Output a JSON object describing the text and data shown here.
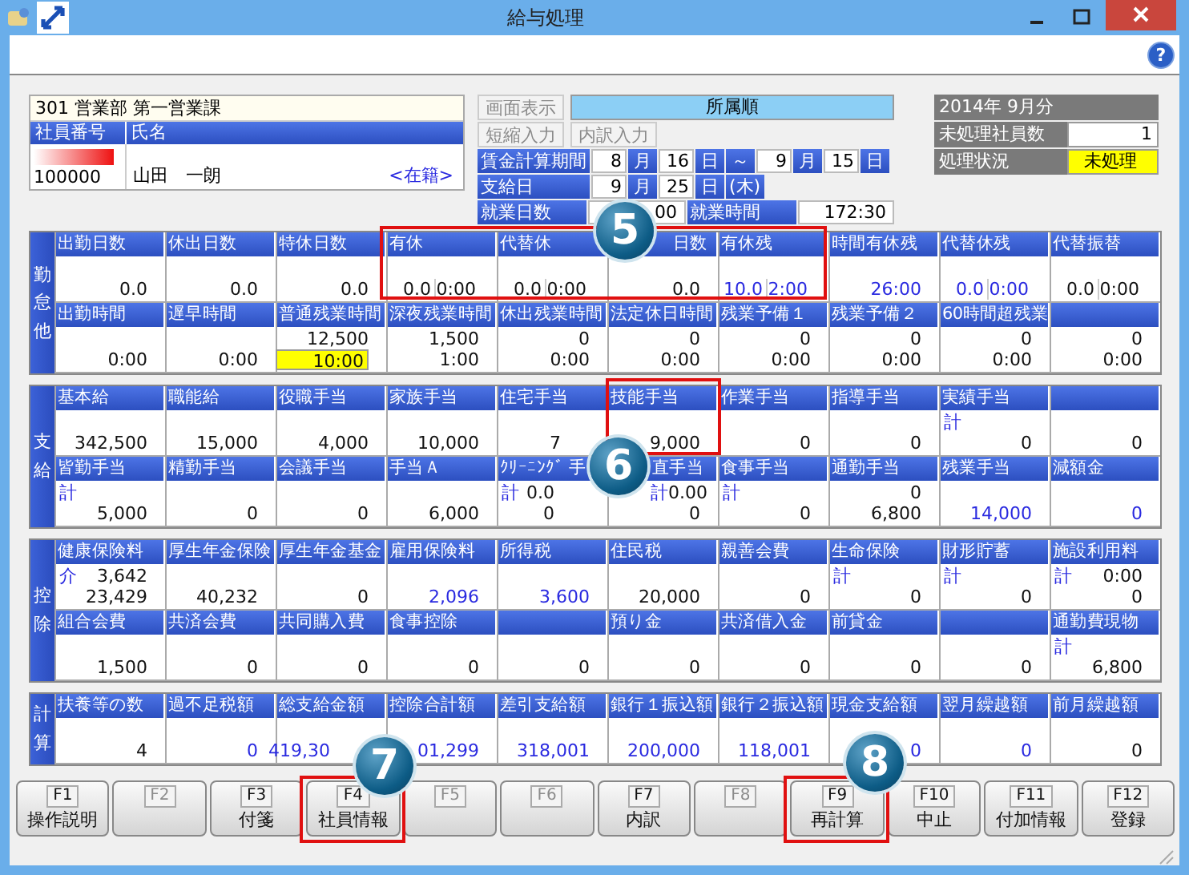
{
  "window": {
    "title": "給与処理"
  },
  "toolbar": {
    "help": "?"
  },
  "employee": {
    "department": "301 営業部 第一営業課",
    "columns": [
      "社員番号",
      "氏名"
    ],
    "number": "100000",
    "name": "山田　一朗",
    "status": "<在籍>"
  },
  "display": {
    "order": "所属順",
    "buttons": [
      {
        "label": "画面表示",
        "disabled": true
      },
      {
        "label": "短縮入力",
        "disabled": true
      },
      {
        "label": "内訳入力",
        "disabled": true
      }
    ]
  },
  "period": [
    [
      {
        "kind": "label",
        "text": "賃金計算期間"
      },
      {
        "kind": "value",
        "text": "8"
      },
      {
        "kind": "unit",
        "text": "月"
      },
      {
        "kind": "value",
        "text": "16"
      },
      {
        "kind": "unit",
        "text": "日"
      },
      {
        "kind": "unit",
        "text": "～"
      },
      {
        "kind": "value",
        "text": "9"
      },
      {
        "kind": "unit",
        "text": "月"
      },
      {
        "kind": "value",
        "text": "15"
      },
      {
        "kind": "unit",
        "text": "日"
      }
    ],
    [
      {
        "kind": "label",
        "text": "支給日"
      },
      {
        "kind": "value",
        "text": "9"
      },
      {
        "kind": "unit",
        "text": "月"
      },
      {
        "kind": "value",
        "text": "25"
      },
      {
        "kind": "unit",
        "text": "日"
      },
      {
        "kind": "unit",
        "text": "(木)"
      }
    ],
    [
      {
        "kind": "label",
        "text": "就業日数"
      },
      {
        "kind": "field",
        "text": "00"
      },
      {
        "kind": "label",
        "text": "就業時間"
      },
      {
        "kind": "field",
        "text": "172:30"
      }
    ]
  ],
  "summary": {
    "title": "2014年 9月分",
    "rows": [
      {
        "label": "未処理社員数",
        "value": "1",
        "alert": false
      },
      {
        "label": "処理状況",
        "value": "未処理",
        "alert": true
      }
    ]
  },
  "sections": [
    {
      "title": "勤怠他",
      "rows": [
        [
          {
            "label": "出勤日数",
            "value": "0.0",
            "emphasized": false
          },
          {
            "label": "休出日数",
            "value": "0.0",
            "emphasized": false
          },
          {
            "label": "特休日数",
            "value": "0.0",
            "emphasized": false
          },
          {
            "label": "有休",
            "parts": [
              "0.0",
              "0:00"
            ],
            "emphasized": false
          },
          {
            "label": "代替休",
            "parts": [
              "0.0",
              "0:00"
            ],
            "emphasized": false
          },
          {
            "label": "日数",
            "value": "0.0",
            "emphasized": false
          },
          {
            "label": "有休残",
            "parts": [
              "10.0",
              "2:00"
            ],
            "emphasized": true
          },
          {
            "label": "時間有休残",
            "value": "26:00",
            "emphasized": true
          },
          {
            "label": "代替休残",
            "parts": [
              "0.0",
              "0:00"
            ],
            "emphasized": true
          },
          {
            "label": "代替振替",
            "parts": [
              "0.0",
              "0:00"
            ],
            "emphasized": false
          }
        ],
        [
          {
            "label": "出勤時間",
            "value": "0:00",
            "emphasized": false,
            "focused": false
          },
          {
            "label": "遅早時間",
            "value": "0:00",
            "emphasized": false,
            "focused": false
          },
          {
            "label": "普通残業時間",
            "upper": "12,500",
            "value": "10:00",
            "emphasized": false,
            "focused": true
          },
          {
            "label": "深夜残業時間",
            "upper": "1,500",
            "value": "1:00",
            "emphasized": false,
            "focused": false
          },
          {
            "label": "休出残業時間",
            "upper": "0",
            "value": "0:00",
            "emphasized": false,
            "focused": false
          },
          {
            "label": "法定休日時間",
            "upper": "0",
            "value": "0:00",
            "emphasized": false,
            "focused": false
          },
          {
            "label": "残業予備１",
            "upper": "0",
            "value": "0:00",
            "emphasized": false,
            "focused": false
          },
          {
            "label": "残業予備２",
            "upper": "0",
            "value": "0:00",
            "emphasized": false,
            "focused": false
          },
          {
            "label": "60時間超残業",
            "upper": "0",
            "value": "0:00",
            "emphasized": false,
            "focused": false
          },
          {
            "upper": "0",
            "value": "0:00",
            "emphasized": false,
            "focused": false
          }
        ]
      ]
    },
    {
      "title": "支給",
      "rows": [
        [
          {
            "label": "基本給",
            "value": "342,500",
            "emphasized": false
          },
          {
            "label": "職能給",
            "value": "15,000",
            "emphasized": false
          },
          {
            "label": "役職手当",
            "value": "4,000",
            "emphasized": false
          },
          {
            "label": "家族手当",
            "value": "10,000",
            "emphasized": false
          },
          {
            "label": "住宅手当",
            "value": "7",
            "emphasized": false
          },
          {
            "label": "技能手当",
            "value": "9,000",
            "emphasized": false
          },
          {
            "label": "作業手当",
            "value": "0",
            "emphasized": false
          },
          {
            "label": "指導手当",
            "value": "0",
            "emphasized": false
          },
          {
            "label": "実績手当",
            "note": "計",
            "value": "0",
            "emphasized": false
          },
          {
            "value": "0",
            "emphasized": false
          }
        ],
        [
          {
            "label": "皆勤手当",
            "note": "計",
            "value": "5,000",
            "emphasized": false
          },
          {
            "label": "精勤手当",
            "value": "0",
            "emphasized": false
          },
          {
            "label": "会議手当",
            "value": "0",
            "emphasized": false
          },
          {
            "label": "手当Ａ",
            "value": "6,000",
            "emphasized": false
          },
          {
            "label": "ｸﾘｰﾆﾝｸﾞ 手",
            "note": "計",
            "upper": "0.0",
            "value": "0",
            "emphasized": false
          },
          {
            "label": "直手当",
            "note": "計",
            "upper": "0.00",
            "value": "0",
            "emphasized": false
          },
          {
            "label": "食事手当",
            "note": "計",
            "value": "0",
            "emphasized": false
          },
          {
            "label": "通勤手当",
            "upper": "0",
            "value": "6,800",
            "emphasized": false
          },
          {
            "label": "残業手当",
            "value": "14,000",
            "emphasized": true
          },
          {
            "label": "減額金",
            "value": "0",
            "emphasized": true
          }
        ]
      ]
    },
    {
      "title": "控除",
      "rows": [
        [
          {
            "label": "健康保険料",
            "note": "介",
            "upper": "3,642",
            "value": "23,429",
            "emphasized": false
          },
          {
            "label": "厚生年金保険",
            "value": "40,232",
            "emphasized": false
          },
          {
            "label": "厚生年金基金",
            "value": "0",
            "emphasized": false
          },
          {
            "label": "雇用保険料",
            "value": "2,096",
            "emphasized": true
          },
          {
            "label": "所得税",
            "value": "3,600",
            "emphasized": true
          },
          {
            "label": "住民税",
            "value": "20,000",
            "emphasized": false
          },
          {
            "label": "親善会費",
            "value": "0",
            "emphasized": false
          },
          {
            "label": "生命保険",
            "note": "計",
            "value": "0",
            "emphasized": false
          },
          {
            "label": "財形貯蓄",
            "note": "計",
            "value": "0",
            "emphasized": false
          },
          {
            "label": "施設利用料",
            "note": "計",
            "upper": "0:00",
            "value": "0",
            "emphasized": false
          }
        ],
        [
          {
            "label": "組合会費",
            "value": "1,500",
            "emphasized": false
          },
          {
            "label": "共済会費",
            "value": "0",
            "emphasized": false
          },
          {
            "label": "共同購入費",
            "value": "0",
            "emphasized": false
          },
          {
            "label": "食事控除",
            "value": "0",
            "emphasized": false
          },
          {
            "value": "0",
            "emphasized": false
          },
          {
            "label": "預り金",
            "value": "0",
            "emphasized": false
          },
          {
            "label": "共済借入金",
            "value": "0",
            "emphasized": false
          },
          {
            "label": "前貸金",
            "value": "0",
            "emphasized": false
          },
          {
            "value": "0",
            "emphasized": false
          },
          {
            "label": "通勤費現物",
            "note": "計",
            "value": "6,800",
            "emphasized": false
          }
        ]
      ]
    },
    {
      "title": "計算",
      "rows": [
        [
          {
            "label": "扶養等の数",
            "value": "4",
            "emphasized": false
          },
          {
            "label": "過不足税額",
            "value": "0",
            "emphasized": true
          },
          {
            "label": "総支給金額",
            "value": "419,30",
            "emphasized": true
          },
          {
            "label": "控除合計額",
            "value": "01,299",
            "emphasized": true
          },
          {
            "label": "差引支給額",
            "value": "318,001",
            "emphasized": true
          },
          {
            "label": "銀行１振込額",
            "value": "200,000",
            "emphasized": true
          },
          {
            "label": "銀行２振込額",
            "value": "118,001",
            "emphasized": true
          },
          {
            "label": "現金支給額",
            "value": "0",
            "emphasized": true
          },
          {
            "label": "翌月繰越額",
            "value": "0",
            "emphasized": true
          },
          {
            "label": "前月繰越額",
            "value": "0",
            "emphasized": false
          }
        ]
      ]
    }
  ],
  "fkeys": [
    {
      "key": "F1",
      "label": "操作説明",
      "disabled": false
    },
    {
      "key": "F2",
      "disabled": true
    },
    {
      "key": "F3",
      "label": "付箋",
      "disabled": false
    },
    {
      "key": "F4",
      "label": "社員情報",
      "disabled": false
    },
    {
      "key": "F5",
      "disabled": true
    },
    {
      "key": "F6",
      "disabled": true
    },
    {
      "key": "F7",
      "label": "内訳",
      "disabled": false
    },
    {
      "key": "F8",
      "disabled": true
    },
    {
      "key": "F9",
      "label": "再計算",
      "disabled": false
    },
    {
      "key": "F10",
      "label": "中止",
      "disabled": false
    },
    {
      "key": "F11",
      "label": "付加情報",
      "disabled": false
    },
    {
      "key": "F12",
      "label": "登録",
      "disabled": false
    }
  ],
  "callouts": [
    {
      "number": "5"
    },
    {
      "number": "6"
    },
    {
      "number": "7"
    },
    {
      "number": "8"
    }
  ]
}
